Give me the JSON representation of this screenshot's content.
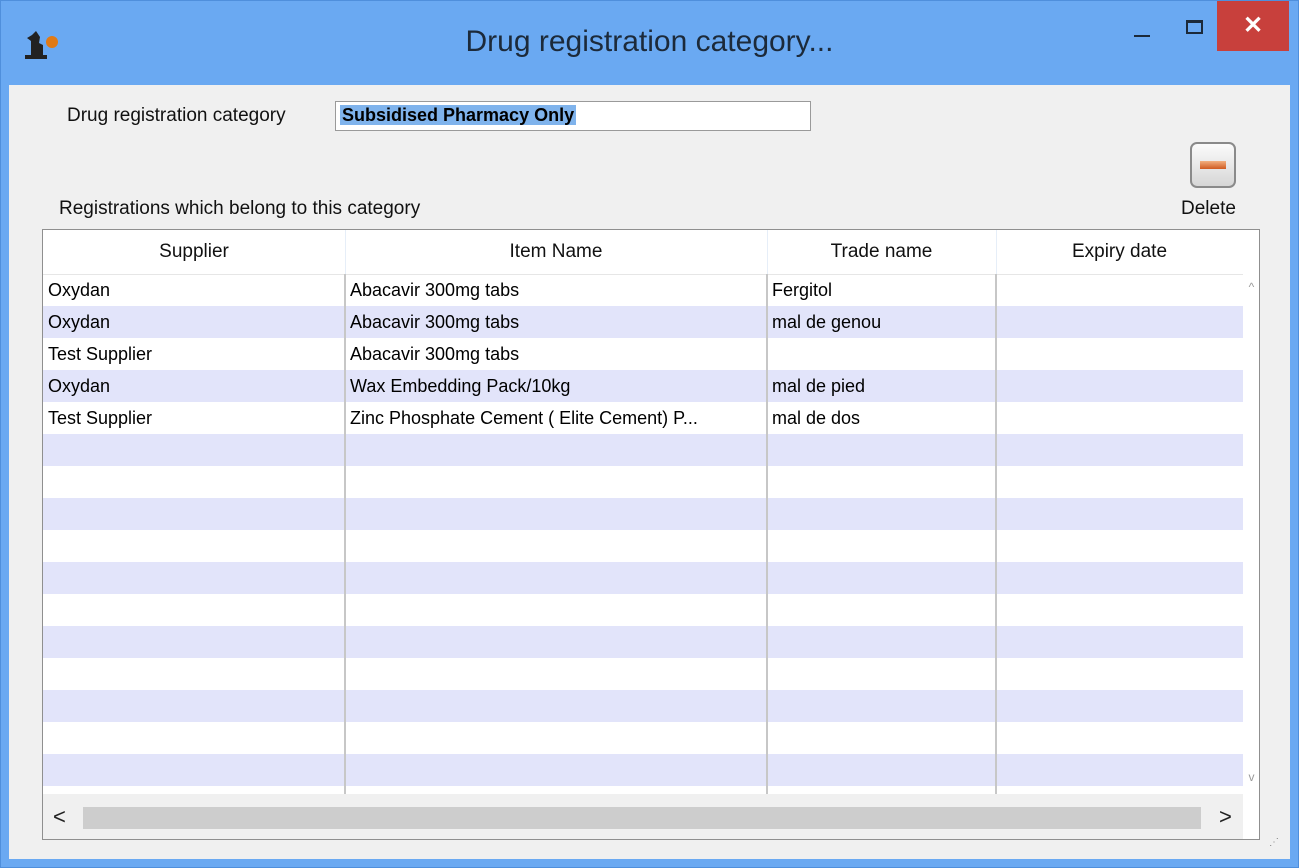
{
  "window": {
    "title": "Drug registration category...",
    "controls": {
      "minimize": "–",
      "maximize": "□",
      "close": "✕"
    }
  },
  "form": {
    "category_label": "Drug registration category",
    "category_value": "Subsidised Pharmacy Only",
    "registrations_label": "Registrations which belong to this category"
  },
  "toolbar": {
    "delete_label": "Delete"
  },
  "table": {
    "columns": [
      "Supplier",
      "Item Name",
      "Trade name",
      "Expiry date"
    ],
    "rows": [
      {
        "supplier": "Oxydan",
        "item_name": "Abacavir 300mg tabs",
        "trade_name": "Fergitol",
        "expiry_date": ""
      },
      {
        "supplier": "Oxydan",
        "item_name": "Abacavir 300mg tabs",
        "trade_name": "mal de genou",
        "expiry_date": ""
      },
      {
        "supplier": "Test Supplier",
        "item_name": "Abacavir 300mg tabs",
        "trade_name": "",
        "expiry_date": ""
      },
      {
        "supplier": "Oxydan",
        "item_name": "Wax Embedding Pack/10kg",
        "trade_name": "mal de pied",
        "expiry_date": ""
      },
      {
        "supplier": "Test Supplier",
        "item_name": "Zinc Phosphate Cement ( Elite Cement) P...",
        "trade_name": "mal de dos",
        "expiry_date": ""
      }
    ]
  },
  "scrollbars": {
    "up": "^",
    "down": "v",
    "left": "<",
    "right": ">"
  },
  "colors": {
    "titlebar": "#6aa9f2",
    "close": "#c8403c",
    "row_alt": "#e2e4fa",
    "selection": "#7fb3ec"
  }
}
